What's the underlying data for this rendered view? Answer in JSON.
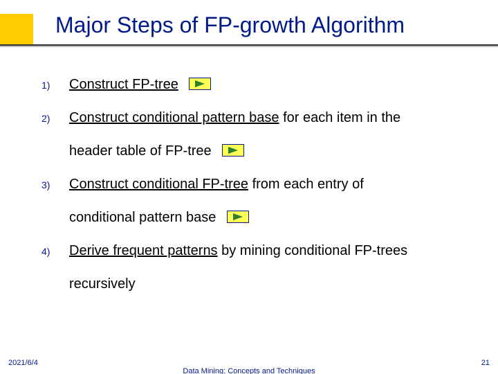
{
  "title": "Major Steps of FP-growth Algorithm",
  "items": [
    {
      "marker": "1)",
      "pre": "",
      "under": "Construct FP-tree",
      "post": "",
      "cont": "",
      "link": true,
      "cont_link": false
    },
    {
      "marker": "2)",
      "pre": "",
      "under": "Construct conditional pattern base",
      "post": " for each item in the",
      "cont": "header table of FP-tree",
      "link": false,
      "cont_link": true
    },
    {
      "marker": "3)",
      "pre": "",
      "under": "Construct conditional FP-tree",
      "post": " from each  entry of",
      "cont": "conditional pattern base",
      "link": false,
      "cont_link": true
    },
    {
      "marker": "4)",
      "pre": "",
      "under": "Derive frequent patterns",
      "post": " by mining conditional FP-trees",
      "cont": "recursively",
      "link": false,
      "cont_link": false
    }
  ],
  "footer": {
    "left": "2021/6/4",
    "center": "Data Mining: Concepts and Techniques",
    "right": "21"
  }
}
